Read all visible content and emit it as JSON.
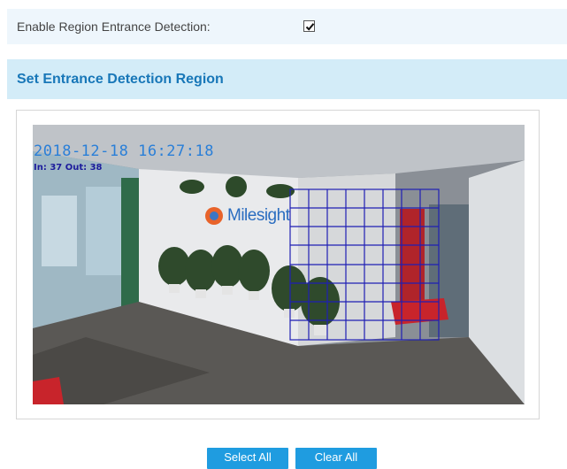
{
  "enable_detection": {
    "label": "Enable Region Entrance Detection:",
    "checked": true
  },
  "region_section": {
    "title": "Set Entrance Detection Region"
  },
  "video": {
    "timestamp": "2018-12-18 16:27:18",
    "counts": "In: 37   Out: 38",
    "logo": "Milesight",
    "grid_color": "#1f1fb4"
  },
  "buttons": {
    "select_all": "Select All",
    "clear_all": "Clear All"
  },
  "colors": {
    "accent": "#1f9ce0",
    "header_bg": "#d3ecf8",
    "title_text": "#1877b8"
  }
}
